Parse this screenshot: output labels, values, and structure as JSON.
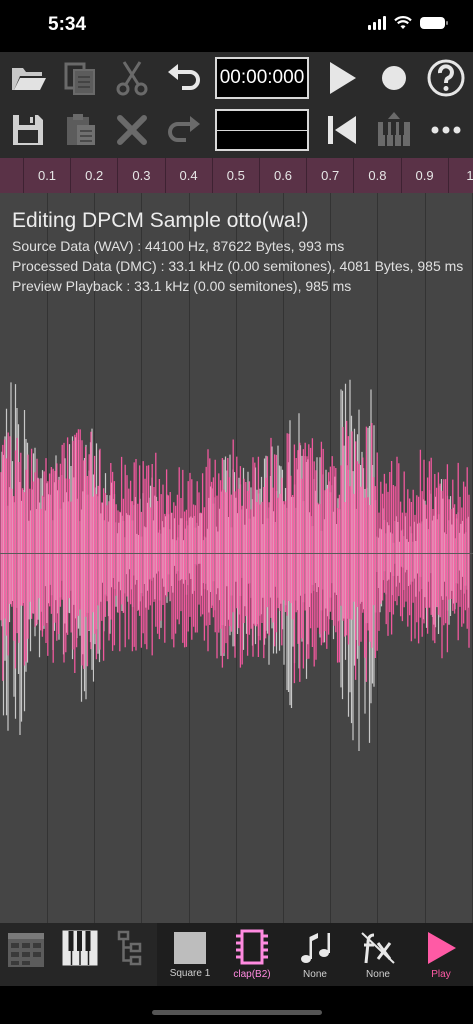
{
  "status_bar": {
    "time": "5:34"
  },
  "toolbar": {
    "time_display": "00:00:000",
    "buttons": [
      "open-icon",
      "copy-icon",
      "cut-icon",
      "undo-icon",
      "play-icon",
      "record-icon",
      "help-icon",
      "save-icon",
      "paste-icon",
      "delete-icon",
      "redo-icon",
      "rewind-icon",
      "piano-qwerty-icon",
      "more-icon"
    ]
  },
  "ruler": {
    "labels": [
      "0.1",
      "0.2",
      "0.3",
      "0.4",
      "0.5",
      "0.6",
      "0.7",
      "0.8",
      "0.9",
      "1."
    ]
  },
  "editor": {
    "title": "Editing DPCM Sample otto(wa!)",
    "source_info": "Source Data (WAV) : 44100 Hz, 87622 Bytes, 993 ms",
    "processed_info": "Processed Data (DMC) : 33.1 kHz (0.00 semitones), 4081 Bytes, 985 ms",
    "preview_info": "Preview Playback : 33.1 kHz (0.00 semitones), 985 ms",
    "colors": {
      "source_wave": "#c8c8c8",
      "processed_wave": "#ff5aa5",
      "background": "#454545"
    }
  },
  "bottom_nav": {
    "items": [
      {
        "label": "Square 1",
        "icon": "square-icon"
      },
      {
        "label": "clap(B2)",
        "icon": "chip-icon",
        "color": "#ff8be0"
      },
      {
        "label": "None",
        "icon": "notes-icon"
      },
      {
        "label": "None",
        "icon": "fx-icon"
      },
      {
        "label": "Play",
        "icon": "play-icon",
        "color": "#ff5aa5"
      }
    ]
  }
}
